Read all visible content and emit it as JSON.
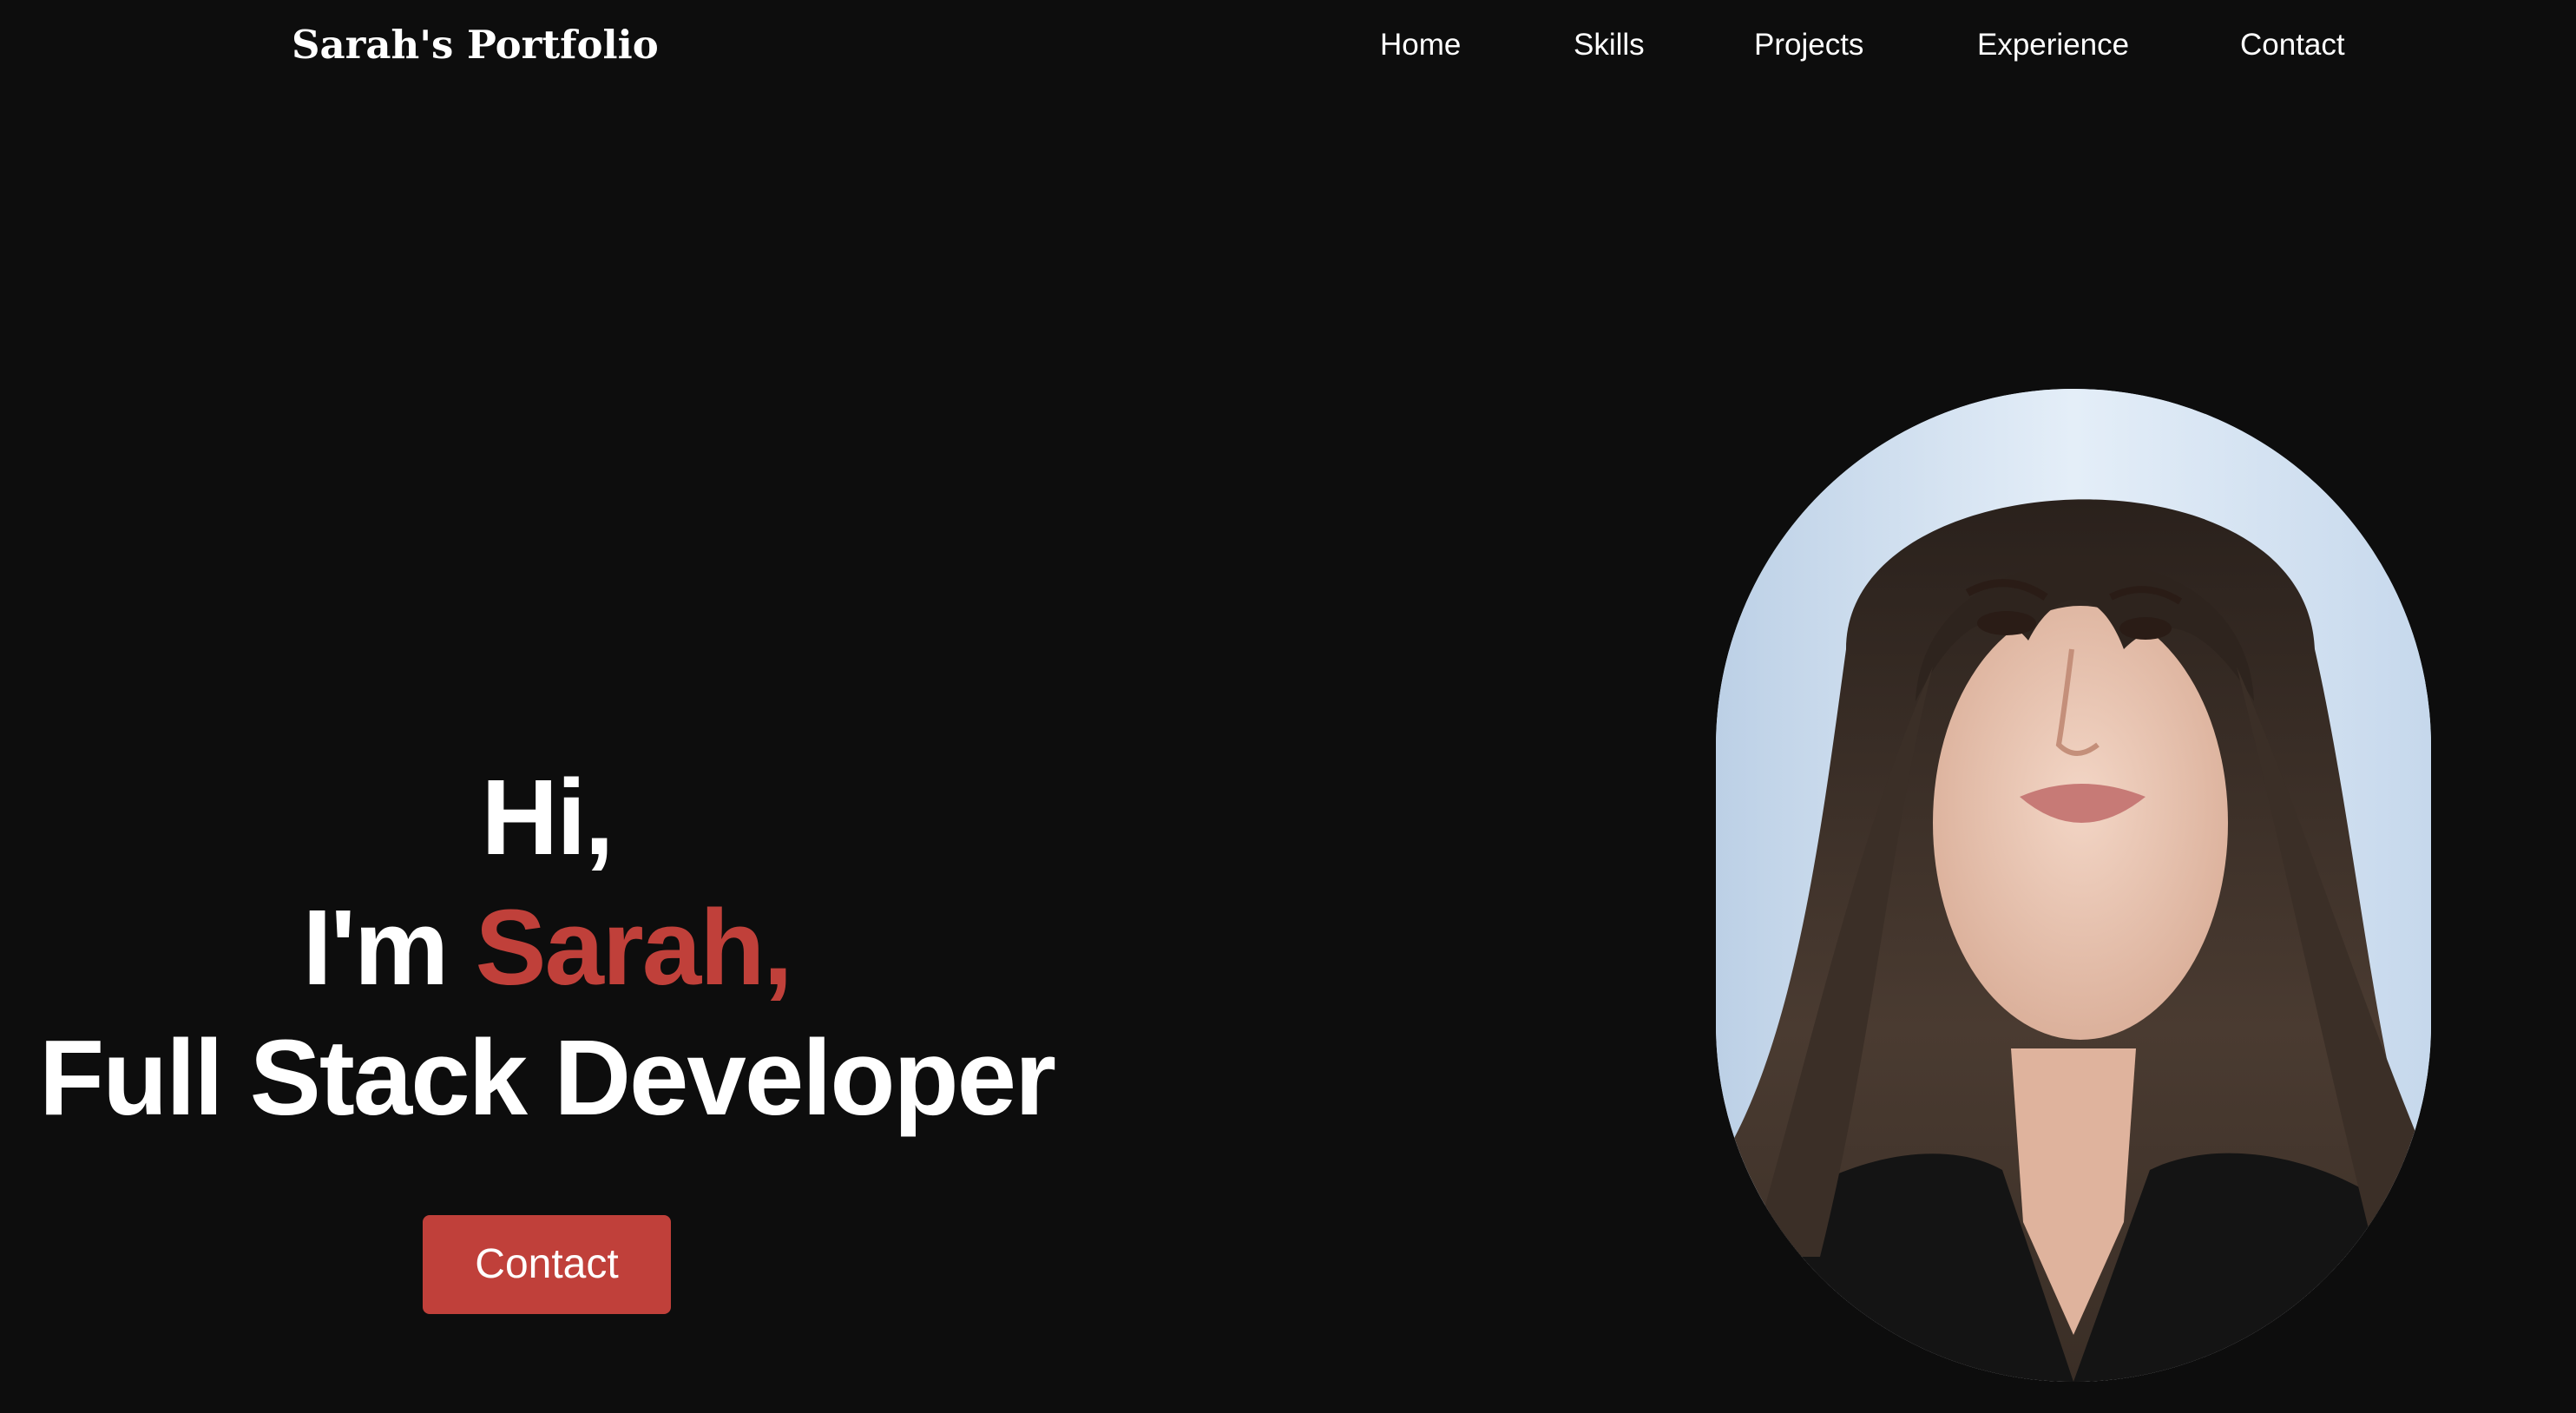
{
  "header": {
    "brand": "Sarah's Portfolio",
    "nav": [
      "Home",
      "Skills",
      "Projects",
      "Experience",
      "Contact"
    ]
  },
  "hero": {
    "greeting": "Hi,",
    "intro_prefix": "I'm",
    "name": "Sarah,",
    "role": "Full Stack Developer",
    "button_label": "Contact"
  },
  "colors": {
    "background": "#0d0d0d",
    "text": "#ffffff",
    "accent": "#c0403a"
  }
}
